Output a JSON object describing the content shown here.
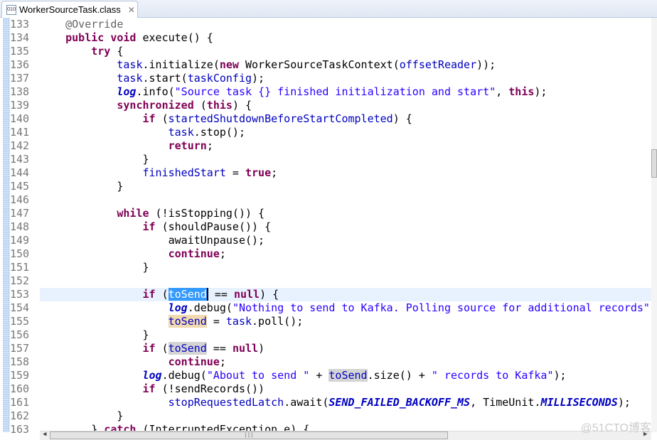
{
  "tab": {
    "title": "WorkerSourceTask.class",
    "icon": "class-file-icon",
    "close": "✕"
  },
  "watermark": "@51CTO博客",
  "lines": [
    {
      "n": "133",
      "t": [
        [
          "p",
          "    "
        ],
        [
          "a",
          "@Override"
        ]
      ]
    },
    {
      "n": "134",
      "t": [
        [
          "p",
          "    "
        ],
        [
          "k",
          "public"
        ],
        [
          "p",
          " "
        ],
        [
          "k",
          "void"
        ],
        [
          "p",
          " execute() {"
        ]
      ]
    },
    {
      "n": "135",
      "t": [
        [
          "p",
          "        "
        ],
        [
          "k",
          "try"
        ],
        [
          "p",
          " {"
        ]
      ]
    },
    {
      "n": "136",
      "t": [
        [
          "p",
          "            "
        ],
        [
          "f",
          "task"
        ],
        [
          "p",
          ".initialize("
        ],
        [
          "k",
          "new"
        ],
        [
          "p",
          " WorkerSourceTaskContext("
        ],
        [
          "f",
          "offsetReader"
        ],
        [
          "p",
          "));"
        ]
      ]
    },
    {
      "n": "137",
      "t": [
        [
          "p",
          "            "
        ],
        [
          "f",
          "task"
        ],
        [
          "p",
          ".start("
        ],
        [
          "f",
          "taskConfig"
        ],
        [
          "p",
          ");"
        ]
      ]
    },
    {
      "n": "138",
      "t": [
        [
          "p",
          "            "
        ],
        [
          "lg",
          "log"
        ],
        [
          "p",
          ".info("
        ],
        [
          "s",
          "\"Source task {} finished initialization and start\""
        ],
        [
          "p",
          ", "
        ],
        [
          "k",
          "this"
        ],
        [
          "p",
          ");"
        ]
      ]
    },
    {
      "n": "139",
      "t": [
        [
          "p",
          "            "
        ],
        [
          "k",
          "synchronized"
        ],
        [
          "p",
          " ("
        ],
        [
          "k",
          "this"
        ],
        [
          "p",
          ") {"
        ]
      ]
    },
    {
      "n": "140",
      "t": [
        [
          "p",
          "                "
        ],
        [
          "k",
          "if"
        ],
        [
          "p",
          " ("
        ],
        [
          "f",
          "startedShutdownBeforeStartCompleted"
        ],
        [
          "p",
          ") {"
        ]
      ]
    },
    {
      "n": "141",
      "t": [
        [
          "p",
          "                    "
        ],
        [
          "f",
          "task"
        ],
        [
          "p",
          ".stop();"
        ]
      ]
    },
    {
      "n": "142",
      "t": [
        [
          "p",
          "                    "
        ],
        [
          "k",
          "return"
        ],
        [
          "p",
          ";"
        ]
      ]
    },
    {
      "n": "143",
      "t": [
        [
          "p",
          "                }"
        ]
      ]
    },
    {
      "n": "144",
      "t": [
        [
          "p",
          "                "
        ],
        [
          "f",
          "finishedStart"
        ],
        [
          "p",
          " = "
        ],
        [
          "k",
          "true"
        ],
        [
          "p",
          ";"
        ]
      ]
    },
    {
      "n": "145",
      "t": [
        [
          "p",
          "            }"
        ]
      ]
    },
    {
      "n": "146",
      "t": []
    },
    {
      "n": "147",
      "t": [
        [
          "p",
          "            "
        ],
        [
          "k",
          "while"
        ],
        [
          "p",
          " (!isStopping()) {"
        ]
      ]
    },
    {
      "n": "148",
      "t": [
        [
          "p",
          "                "
        ],
        [
          "k",
          "if"
        ],
        [
          "p",
          " (shouldPause()) {"
        ]
      ]
    },
    {
      "n": "149",
      "t": [
        [
          "p",
          "                    awaitUnpause();"
        ]
      ]
    },
    {
      "n": "150",
      "t": [
        [
          "p",
          "                    "
        ],
        [
          "k",
          "continue"
        ],
        [
          "p",
          ";"
        ]
      ]
    },
    {
      "n": "151",
      "t": [
        [
          "p",
          "                }"
        ]
      ]
    },
    {
      "n": "152",
      "t": []
    },
    {
      "n": "153",
      "cur": true,
      "t": [
        [
          "p",
          "                "
        ],
        [
          "k",
          "if"
        ],
        [
          "p",
          " ("
        ],
        [
          "f sel",
          "toSend"
        ],
        [
          "p",
          " == "
        ],
        [
          "k",
          "null"
        ],
        [
          "p",
          ") {"
        ]
      ]
    },
    {
      "n": "154",
      "t": [
        [
          "p",
          "                    "
        ],
        [
          "lg",
          "log"
        ],
        [
          "p",
          ".debug("
        ],
        [
          "s",
          "\"Nothing to send to Kafka. Polling source for additional records\""
        ],
        [
          "p",
          ");"
        ]
      ]
    },
    {
      "n": "155",
      "t": [
        [
          "p",
          "                    "
        ],
        [
          "f occw",
          "toSend"
        ],
        [
          "p",
          " = "
        ],
        [
          "f",
          "task"
        ],
        [
          "p",
          ".poll();"
        ]
      ]
    },
    {
      "n": "156",
      "t": [
        [
          "p",
          "                }"
        ]
      ]
    },
    {
      "n": "157",
      "t": [
        [
          "p",
          "                "
        ],
        [
          "k",
          "if"
        ],
        [
          "p",
          " ("
        ],
        [
          "f occ",
          "toSend"
        ],
        [
          "p",
          " == "
        ],
        [
          "k",
          "null"
        ],
        [
          "p",
          ")"
        ]
      ]
    },
    {
      "n": "158",
      "t": [
        [
          "p",
          "                    "
        ],
        [
          "k",
          "continue"
        ],
        [
          "p",
          ";"
        ]
      ]
    },
    {
      "n": "159",
      "t": [
        [
          "p",
          "                "
        ],
        [
          "lg",
          "log"
        ],
        [
          "p",
          ".debug("
        ],
        [
          "s",
          "\"About to send \""
        ],
        [
          "p",
          " + "
        ],
        [
          "f occ",
          "toSend"
        ],
        [
          "p",
          ".size() + "
        ],
        [
          "s",
          "\" records to Kafka\""
        ],
        [
          "p",
          ");"
        ]
      ]
    },
    {
      "n": "160",
      "t": [
        [
          "p",
          "                "
        ],
        [
          "k",
          "if"
        ],
        [
          "p",
          " (!sendRecords())"
        ]
      ]
    },
    {
      "n": "161",
      "t": [
        [
          "p",
          "                    "
        ],
        [
          "f",
          "stopRequestedLatch"
        ],
        [
          "p",
          ".await("
        ],
        [
          "sf",
          "SEND_FAILED_BACKOFF_MS"
        ],
        [
          "p",
          ", TimeUnit."
        ],
        [
          "sf",
          "MILLISECONDS"
        ],
        [
          "p",
          ");"
        ]
      ]
    },
    {
      "n": "162",
      "t": [
        [
          "p",
          "            }"
        ]
      ]
    },
    {
      "n": "163",
      "t": [
        [
          "p",
          "        } "
        ],
        [
          "k",
          "catch"
        ],
        [
          "p",
          " (InterruptedException e) {"
        ]
      ]
    }
  ]
}
